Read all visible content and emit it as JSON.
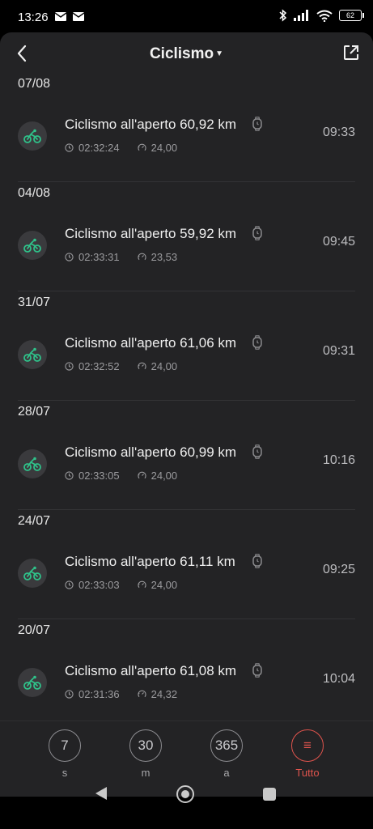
{
  "status_bar": {
    "time": "13:26",
    "battery": "62"
  },
  "header": {
    "title": "Ciclismo"
  },
  "activities": [
    {
      "date": "07/08",
      "name": "Ciclismo all'aperto",
      "distance": "60,92 km",
      "duration": "02:32:24",
      "value": "24,00",
      "time": "09:33"
    },
    {
      "date": "04/08",
      "name": "Ciclismo all'aperto",
      "distance": "59,92 km",
      "duration": "02:33:31",
      "value": "23,53",
      "time": "09:45"
    },
    {
      "date": "31/07",
      "name": "Ciclismo all'aperto",
      "distance": "61,06 km",
      "duration": "02:32:52",
      "value": "24,00",
      "time": "09:31"
    },
    {
      "date": "28/07",
      "name": "Ciclismo all'aperto",
      "distance": "60,99 km",
      "duration": "02:33:05",
      "value": "24,00",
      "time": "10:16"
    },
    {
      "date": "24/07",
      "name": "Ciclismo all'aperto",
      "distance": "61,11 km",
      "duration": "02:33:03",
      "value": "24,00",
      "time": "09:25"
    },
    {
      "date": "20/07",
      "name": "Ciclismo all'aperto",
      "distance": "61,08 km",
      "duration": "02:31:36",
      "value": "24,32",
      "time": "10:04"
    }
  ],
  "tabs": [
    {
      "value": "7",
      "label": "s"
    },
    {
      "value": "30",
      "label": "m"
    },
    {
      "value": "365",
      "label": "a"
    },
    {
      "value": "≡",
      "label": "Tutto"
    }
  ],
  "colors": {
    "accent": "#e0544d",
    "bike_green": "#2fc28a",
    "background": "#232325"
  }
}
